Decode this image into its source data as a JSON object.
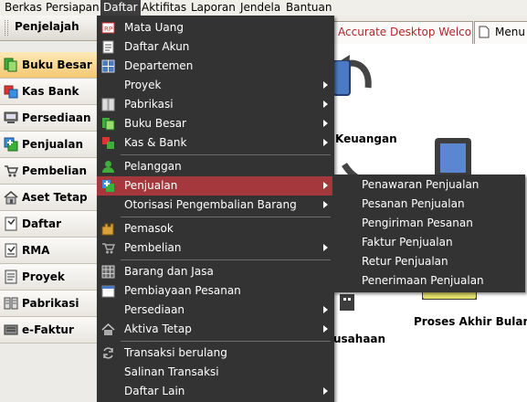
{
  "menubar": {
    "items": [
      "Berkas",
      "Persiapan",
      "Daftar",
      "Aktifitas",
      "Laporan",
      "Jendela",
      "Bantuan"
    ],
    "active": "Daftar"
  },
  "sidebar": {
    "title": "Penjelajah",
    "items": [
      {
        "label": "Buku Besar",
        "icon": "ledger-icon",
        "active": true
      },
      {
        "label": "Kas Bank",
        "icon": "cash-bank-icon"
      },
      {
        "label": "Persediaan",
        "icon": "inventory-icon"
      },
      {
        "label": "Penjualan",
        "icon": "sales-icon"
      },
      {
        "label": "Pembelian",
        "icon": "cart-icon"
      },
      {
        "label": "Aset Tetap",
        "icon": "house-icon"
      },
      {
        "label": "Daftar",
        "icon": "list-icon"
      },
      {
        "label": "RMA",
        "icon": "rma-icon"
      },
      {
        "label": "Proyek",
        "icon": "project-icon"
      },
      {
        "label": "Pabrikasi",
        "icon": "factory-icon"
      },
      {
        "label": "e-Faktur",
        "icon": "efaktur-icon"
      }
    ]
  },
  "tabs": [
    {
      "label": "Accurate Desktop Welcome..."
    },
    {
      "label": "Menu F"
    }
  ],
  "content": {
    "labels": [
      "Keuangan",
      "Proses Akhir Bulan",
      "usahaan"
    ]
  },
  "daftar_menu": {
    "items": [
      {
        "label": "Mata Uang",
        "icon": "currency-icon",
        "submenu": false
      },
      {
        "label": "Daftar Akun",
        "icon": "accounts-icon",
        "submenu": false
      },
      {
        "label": "Departemen",
        "icon": "department-icon",
        "submenu": false
      },
      {
        "label": "Proyek",
        "icon": "",
        "submenu": true
      },
      {
        "label": "Pabrikasi",
        "icon": "factory-icon",
        "submenu": true
      },
      {
        "label": "Buku Besar",
        "icon": "ledger-icon",
        "submenu": true
      },
      {
        "label": "Kas & Bank",
        "icon": "cash-bank-icon",
        "submenu": true
      },
      {
        "label": "Pelanggan",
        "icon": "customer-icon",
        "submenu": false
      },
      {
        "label": "Penjualan",
        "icon": "sales-icon",
        "submenu": true,
        "active": true
      },
      {
        "label": "Otorisasi Pengembalian Barang",
        "icon": "",
        "submenu": true
      },
      {
        "label": "Pemasok",
        "icon": "supplier-icon",
        "submenu": false
      },
      {
        "label": "Pembelian",
        "icon": "cart-icon",
        "submenu": true
      },
      {
        "label": "Barang dan Jasa",
        "icon": "items-icon",
        "submenu": false
      },
      {
        "label": "Pembiayaan Pesanan",
        "icon": "calendar-icon",
        "submenu": false
      },
      {
        "label": "Persediaan",
        "icon": "",
        "submenu": true
      },
      {
        "label": "Aktiva Tetap",
        "icon": "house-icon",
        "submenu": true
      },
      {
        "label": "Transaksi berulang",
        "icon": "recurring-icon",
        "submenu": false
      },
      {
        "label": "Salinan Transaksi",
        "icon": "",
        "submenu": false
      },
      {
        "label": "Daftar Lain",
        "icon": "",
        "submenu": true
      }
    ]
  },
  "penjualan_submenu": {
    "items": [
      "Penawaran Penjualan",
      "Pesanan Penjualan",
      "Pengiriman Pesanan",
      "Faktur Penjualan",
      "Retur Penjualan",
      "Penerimaan Penjualan"
    ]
  },
  "colors": {
    "menu_bg": "#333333",
    "menu_highlight": "#a4383c",
    "sidebar_active": "#f4c872",
    "welcome_tab_text": "#b0262a"
  }
}
